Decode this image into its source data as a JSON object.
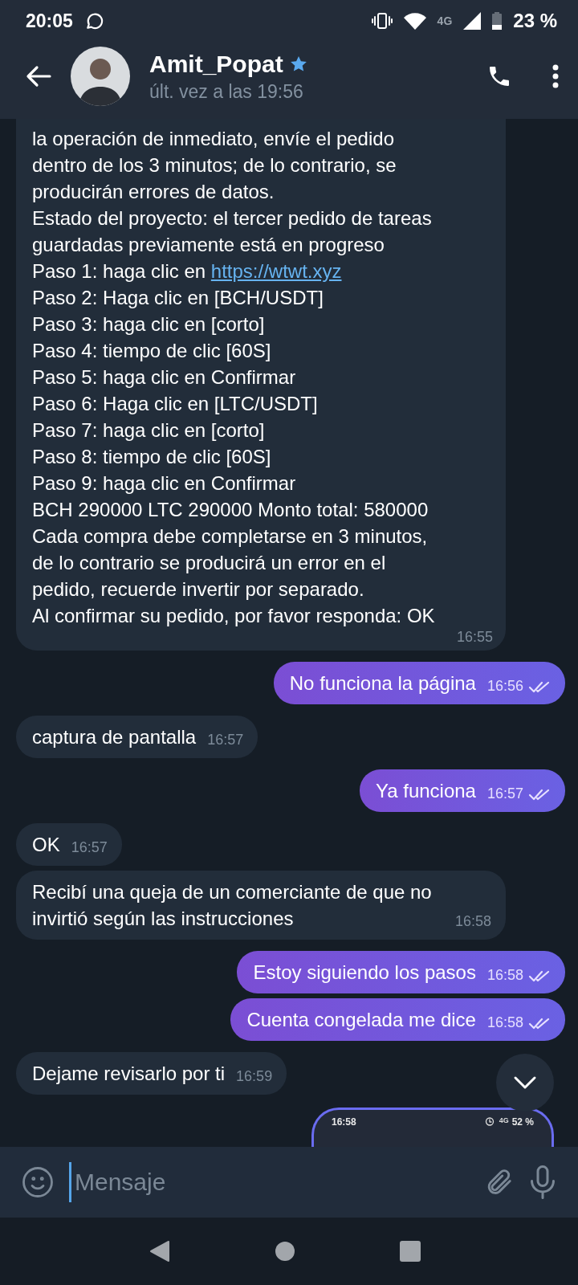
{
  "status_bar": {
    "time": "20:05",
    "network": "4G",
    "battery": "23 %"
  },
  "header": {
    "name": "Amit_Popat",
    "starred": true,
    "last_seen": "últ. vez a las 19:56"
  },
  "messages": [
    {
      "kind": "lines",
      "outgoing": false,
      "time": "16:55",
      "lines": [
        {
          "text": "la operación de inmediato, envíe el pedido"
        },
        {
          "text": "dentro de los 3 minutos; de lo contrario, se"
        },
        {
          "text": "producirán errores de datos."
        },
        {
          "text": "Estado del proyecto: el tercer pedido de tareas"
        },
        {
          "text": "guardadas previamente está en progreso"
        },
        {
          "text": "Paso 1: haga clic en",
          "link": "https://wtwt.xyz"
        },
        {
          "text": "Paso 2: Haga clic en [BCH/USDT]"
        },
        {
          "text": "Paso 3: haga clic en [corto]"
        },
        {
          "text": "Paso 4: tiempo de clic [60S]"
        },
        {
          "text": "Paso 5: haga clic en Confirmar"
        },
        {
          "text": "Paso 6: Haga clic en [LTC/USDT]"
        },
        {
          "text": "Paso 7: haga clic en [corto]"
        },
        {
          "text": "Paso 8: tiempo de clic [60S]"
        },
        {
          "text": "Paso 9: haga clic en Confirmar"
        },
        {
          "text": "BCH 290000 LTC 290000 Monto total: 580000"
        },
        {
          "text": "Cada compra debe completarse en 3 minutos,"
        },
        {
          "text": "de lo contrario se producirá un error en el"
        },
        {
          "text": "pedido, recuerde invertir por separado."
        },
        {
          "text": "Al confirmar su pedido, por favor responda: OK"
        }
      ]
    },
    {
      "kind": "text",
      "outgoing": true,
      "text": "No funciona la página",
      "time": "16:56",
      "read": true
    },
    {
      "kind": "text",
      "outgoing": false,
      "text": "captura de pantalla",
      "time": "16:57"
    },
    {
      "kind": "text",
      "outgoing": true,
      "text": "Ya funciona",
      "time": "16:57",
      "read": true
    },
    {
      "kind": "text",
      "outgoing": false,
      "text": "OK",
      "time": "16:57"
    },
    {
      "kind": "text",
      "outgoing": false,
      "text": "Recibí una queja de un comerciante de que no invirtió según las instrucciones",
      "time": "16:58"
    },
    {
      "kind": "text",
      "outgoing": true,
      "text": "Estoy siguiendo los pasos",
      "time": "16:58",
      "read": true
    },
    {
      "kind": "text",
      "outgoing": true,
      "text": "Cuenta congelada me dice",
      "time": "16:58",
      "read": true
    },
    {
      "kind": "text",
      "outgoing": false,
      "text": "Dejame revisarlo por ti",
      "time": "16:59"
    },
    {
      "kind": "image",
      "outgoing": true,
      "shot": {
        "time": "16:58",
        "network": "4G",
        "battery": "52 %"
      }
    }
  ],
  "composer": {
    "placeholder": "Mensaje"
  }
}
